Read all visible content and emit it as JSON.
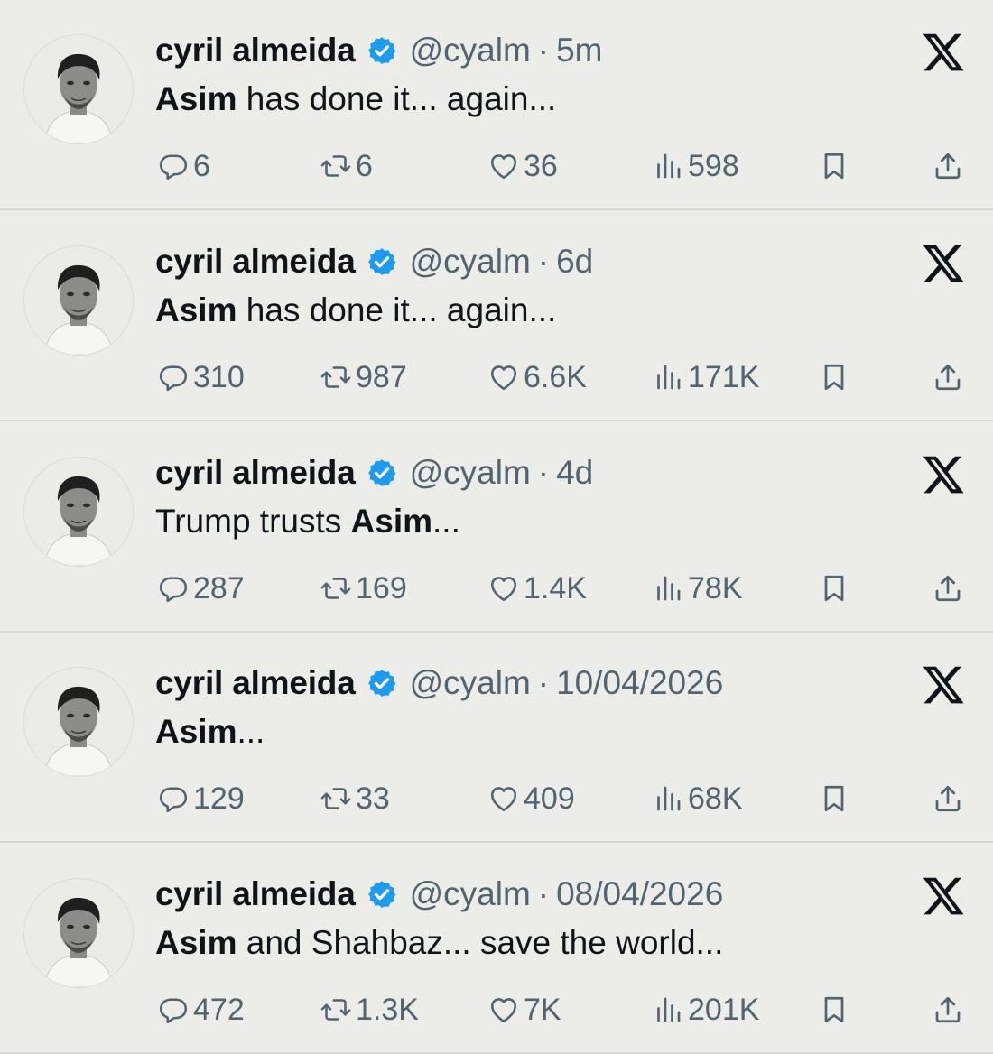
{
  "tweets": [
    {
      "name": "cyril almeida",
      "handle": "@cyalm",
      "separator": "·",
      "time": "5m",
      "text_parts": [
        {
          "t": "Asim",
          "bold": true
        },
        {
          "t": " has done it... again...",
          "bold": false
        }
      ],
      "replies": "6",
      "retweets": "6",
      "likes": "36",
      "views": "598"
    },
    {
      "name": "cyril almeida",
      "handle": "@cyalm",
      "separator": "·",
      "time": "6d",
      "text_parts": [
        {
          "t": "Asim",
          "bold": true
        },
        {
          "t": " has done it... again...",
          "bold": false
        }
      ],
      "replies": "310",
      "retweets": "987",
      "likes": "6.6K",
      "views": "171K"
    },
    {
      "name": "cyril almeida",
      "handle": "@cyalm",
      "separator": "·",
      "time": "4d",
      "text_parts": [
        {
          "t": "Trump trusts ",
          "bold": false
        },
        {
          "t": "Asim",
          "bold": true
        },
        {
          "t": "...",
          "bold": false
        }
      ],
      "replies": "287",
      "retweets": "169",
      "likes": "1.4K",
      "views": "78K"
    },
    {
      "name": "cyril almeida",
      "handle": "@cyalm",
      "separator": "·",
      "time": "10/04/2026",
      "text_parts": [
        {
          "t": "Asim",
          "bold": true
        },
        {
          "t": "...",
          "bold": false
        }
      ],
      "replies": "129",
      "retweets": "33",
      "likes": "409",
      "views": "68K"
    },
    {
      "name": "cyril almeida",
      "handle": "@cyalm",
      "separator": "·",
      "time": "08/04/2026",
      "text_parts": [
        {
          "t": "Asim",
          "bold": true
        },
        {
          "t": " and Shahbaz... save the world...",
          "bold": false
        }
      ],
      "replies": "472",
      "retweets": "1.3K",
      "likes": "7K",
      "views": "201K"
    }
  ],
  "icons": {
    "verified": "verified-badge-icon",
    "platform": "x-logo-icon",
    "reply": "reply-icon",
    "retweet": "retweet-icon",
    "like": "heart-icon",
    "views": "views-icon",
    "bookmark": "bookmark-icon",
    "share": "share-icon"
  },
  "colors": {
    "background": "#ecece8",
    "text": "#0f1419",
    "secondary": "#536471",
    "verified": "#1d9bf0",
    "divider": "#d6d6d2"
  }
}
